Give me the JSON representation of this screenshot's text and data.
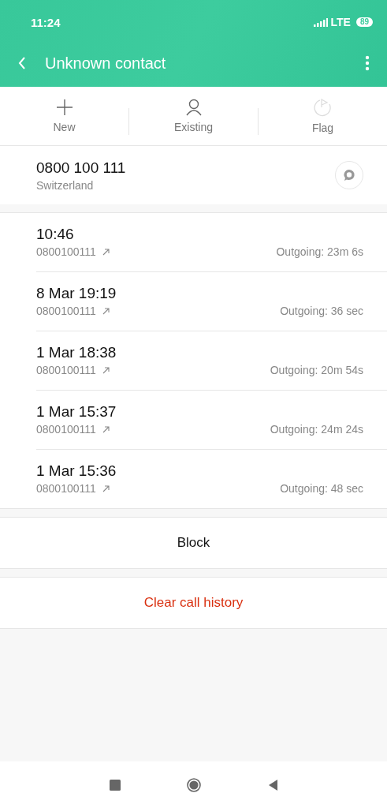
{
  "status_bar": {
    "time": "11:24",
    "network": "LTE",
    "battery": "89"
  },
  "app_bar": {
    "title": "Unknown contact"
  },
  "actions": [
    {
      "kind": "new",
      "label": "New",
      "disabled": false
    },
    {
      "kind": "existing",
      "label": "Existing",
      "disabled": false
    },
    {
      "kind": "flag",
      "label": "Flag",
      "disabled": true
    }
  ],
  "contact": {
    "number": "0800 100 111",
    "location": "Switzerland"
  },
  "calls": [
    {
      "time": "10:46",
      "number": "0800100111",
      "detail": "Outgoing: 23m 6s"
    },
    {
      "time": "8 Mar 19:19",
      "number": "0800100111",
      "detail": "Outgoing: 36 sec"
    },
    {
      "time": "1 Mar 18:38",
      "number": "0800100111",
      "detail": "Outgoing: 20m 54s"
    },
    {
      "time": "1 Mar 15:37",
      "number": "0800100111",
      "detail": "Outgoing: 24m 24s"
    },
    {
      "time": "1 Mar 15:36",
      "number": "0800100111",
      "detail": "Outgoing: 48 sec"
    }
  ],
  "buttons": [
    {
      "kind": "normal",
      "label": "Block"
    },
    {
      "kind": "danger",
      "label": "Clear call history"
    }
  ]
}
